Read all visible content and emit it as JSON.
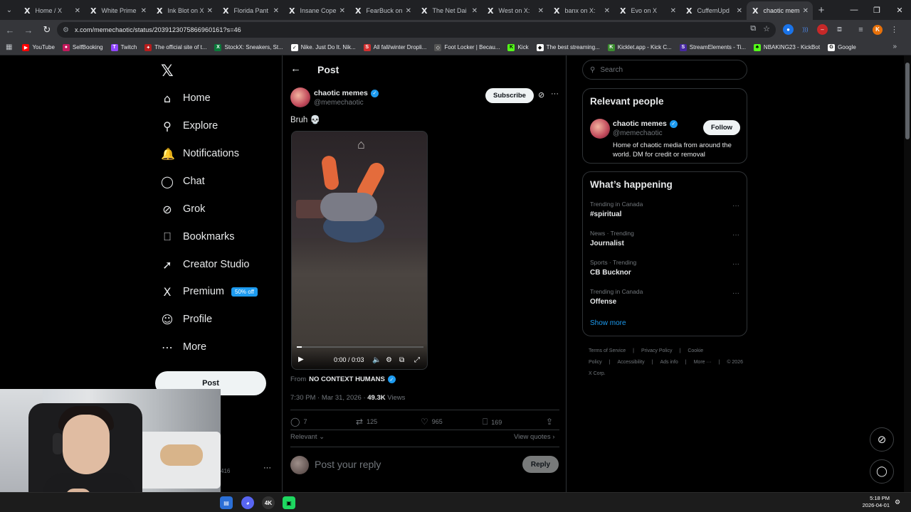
{
  "browser": {
    "tabs": [
      {
        "title": "Home / X",
        "active": false
      },
      {
        "title": "White Prime",
        "active": false
      },
      {
        "title": "Ink Blot on X",
        "active": false
      },
      {
        "title": "Florida Pant",
        "active": false
      },
      {
        "title": "Insane Cope",
        "active": false
      },
      {
        "title": "FearBuck on",
        "active": false
      },
      {
        "title": "The Net Dai",
        "active": false
      },
      {
        "title": "West on X:",
        "active": false
      },
      {
        "title": "banx on X:",
        "active": false
      },
      {
        "title": "Evo on X",
        "active": false
      },
      {
        "title": "CuffemUpd",
        "active": false
      },
      {
        "title": "chaotic mem",
        "active": true
      }
    ],
    "url": "x.com/memechaotic/status/2039123075866960161?s=46",
    "profile_initial": "K",
    "bookmarks": [
      {
        "label": "YouTube",
        "color": "#ff0000",
        "glyph": "▶"
      },
      {
        "label": "SelfBooking",
        "color": "#c2185b",
        "glyph": "●"
      },
      {
        "label": "Twitch",
        "color": "#9146ff",
        "glyph": "T"
      },
      {
        "label": "The official site of t...",
        "color": "#b71c1c",
        "glyph": "✦"
      },
      {
        "label": "StockX: Sneakers, St...",
        "color": "#0a7a3a",
        "glyph": "X"
      },
      {
        "label": "Nike. Just Do It. Nik...",
        "color": "#ffffff",
        "glyph": "✓"
      },
      {
        "label": "All fall/winter Dropli...",
        "color": "#d32f2f",
        "glyph": "S"
      },
      {
        "label": "Foot Locker | Becau...",
        "color": "#555555",
        "glyph": "◇"
      },
      {
        "label": "Kick",
        "color": "#53fc18",
        "glyph": "K"
      },
      {
        "label": "The best streaming...",
        "color": "#ffffff",
        "glyph": "◆"
      },
      {
        "label": "Kicklet.app - Kick C...",
        "color": "#3b8d2f",
        "glyph": "K"
      },
      {
        "label": "StreamElements - Ti...",
        "color": "#4527a0",
        "glyph": "S"
      },
      {
        "label": "NBAKING23 - KickBot",
        "color": "#53fc18",
        "glyph": "♣"
      },
      {
        "label": "Google",
        "color": "#ffffff",
        "glyph": "G"
      }
    ]
  },
  "nav": {
    "items": [
      {
        "id": "home",
        "label": "Home",
        "icon": "⌂"
      },
      {
        "id": "explore",
        "label": "Explore",
        "icon": "⚲"
      },
      {
        "id": "notifications",
        "label": "Notifications",
        "icon": "🔔"
      },
      {
        "id": "chat",
        "label": "Chat",
        "icon": "◯"
      },
      {
        "id": "grok",
        "label": "Grok",
        "icon": "⊘"
      },
      {
        "id": "bookmarks",
        "label": "Bookmarks",
        "icon": "⎕"
      },
      {
        "id": "creator-studio",
        "label": "Creator Studio",
        "icon": "➚"
      },
      {
        "id": "premium",
        "label": "Premium",
        "icon": "X"
      },
      {
        "id": "profile",
        "label": "Profile",
        "icon": "☺"
      },
      {
        "id": "more",
        "label": "More",
        "icon": "⋯"
      }
    ],
    "premium_badge": "50% off",
    "post_label": "Post",
    "account_stub": "416"
  },
  "post": {
    "header_title": "Post",
    "author_name": "chaotic memes",
    "author_handle": "@memechaotic",
    "subscribe_label": "Subscribe",
    "text": "Bruh 💀",
    "video": {
      "current": "0:00",
      "duration": "0:03",
      "progress": 0.04
    },
    "from_prefix": "From",
    "from_name": "NO CONTEXT HUMANS",
    "timestamp": "7:30 PM · Mar 31, 2026 · ",
    "views_count": "49.3K",
    "views_label": " Views",
    "stats": {
      "replies": "7",
      "reposts": "125",
      "likes": "965",
      "bookmarks": "169"
    },
    "sort_label": "Relevant ⌄",
    "view_quotes": "View quotes ›",
    "reply_placeholder": "Post your reply",
    "reply_button": "Reply"
  },
  "sidebar": {
    "search_placeholder": "Search",
    "relevant_title": "Relevant people",
    "person": {
      "name": "chaotic memes",
      "handle": "@memechaotic",
      "follow_label": "Follow",
      "bio": "Home of chaotic media from around the world. DM for credit or removal"
    },
    "happening_title": "What’s happening",
    "trends": [
      {
        "category": "Trending in Canada",
        "name": "#spiritual"
      },
      {
        "category": "News · Trending",
        "name": "Journalist"
      },
      {
        "category": "Sports · Trending",
        "name": "CB Bucknor"
      },
      {
        "category": "Trending in Canada",
        "name": "Offense"
      }
    ],
    "show_more": "Show more",
    "footer_links": [
      "Terms of Service",
      "|",
      "Privacy Policy",
      "|",
      "Cookie Policy",
      "|",
      "Accessibility",
      "|",
      "Ads info",
      "|",
      "More ···",
      "|",
      "© 2026 X Corp."
    ]
  },
  "taskbar": {
    "time": "5:18 PM",
    "date": "2026-04-01"
  }
}
